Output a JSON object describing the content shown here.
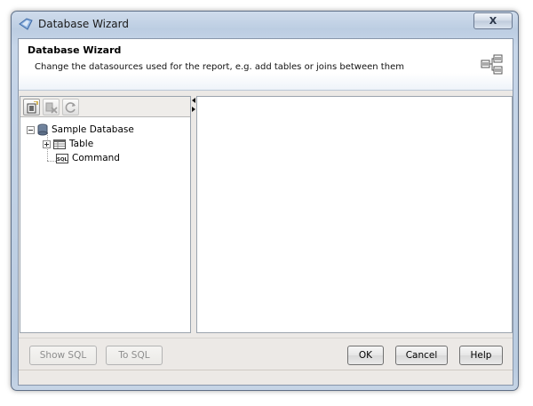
{
  "window": {
    "title": "Database Wizard",
    "close_label": "X"
  },
  "header": {
    "title": "Database Wizard",
    "subtitle": "Change the datasources used for the report, e.g. add tables or joins between them",
    "icon": "table-join-icon"
  },
  "toolbar": {
    "buttons": [
      {
        "icon": "add-datasource-icon",
        "enabled": true
      },
      {
        "icon": "remove-icon",
        "enabled": false
      },
      {
        "icon": "refresh-icon",
        "enabled": false
      }
    ]
  },
  "tree": {
    "root": {
      "label": "Sample Database",
      "icon": "database-icon",
      "expanded": true
    },
    "children": [
      {
        "label": "Table",
        "icon": "table-icon",
        "expanded": false
      },
      {
        "label": "Command",
        "icon": "sql-icon"
      }
    ]
  },
  "footer": {
    "show_sql": "Show SQL",
    "to_sql": "To SQL",
    "ok": "OK",
    "cancel": "Cancel",
    "help": "Help"
  },
  "colors": {
    "frame": "#bccde2",
    "client_bg": "#ece9e6",
    "border": "#9aa3ad"
  }
}
